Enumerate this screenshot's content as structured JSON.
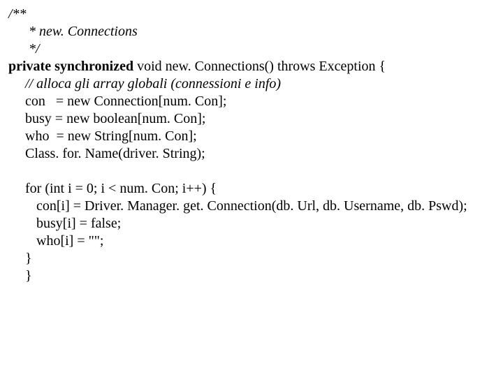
{
  "c1": "/**",
  "c2": " * new. Connections",
  "c3": " */",
  "pv": "private",
  "sy": "synchronized",
  "sig_rest": " void new. Connections() throws Exception {",
  "cm_alloc": "// alloca gli array globali (connessioni e info)",
  "l_con": "con   = new Connection[num. Con];",
  "l_busy": "busy = new boolean[num. Con];",
  "l_who": "who  = new String[num. Con];",
  "l_class": "Class. for. Name(driver. String);",
  "for_line": "for (int i = 0; i < num. Con; i++) {",
  "f_con": "con[i] = Driver. Manager. get. Connection(db. Url, db. Username, db. Pswd);",
  "f_busy": "busy[i] = false;",
  "f_who": "who[i] = \"\";",
  "brace1": "}",
  "brace2": "}"
}
